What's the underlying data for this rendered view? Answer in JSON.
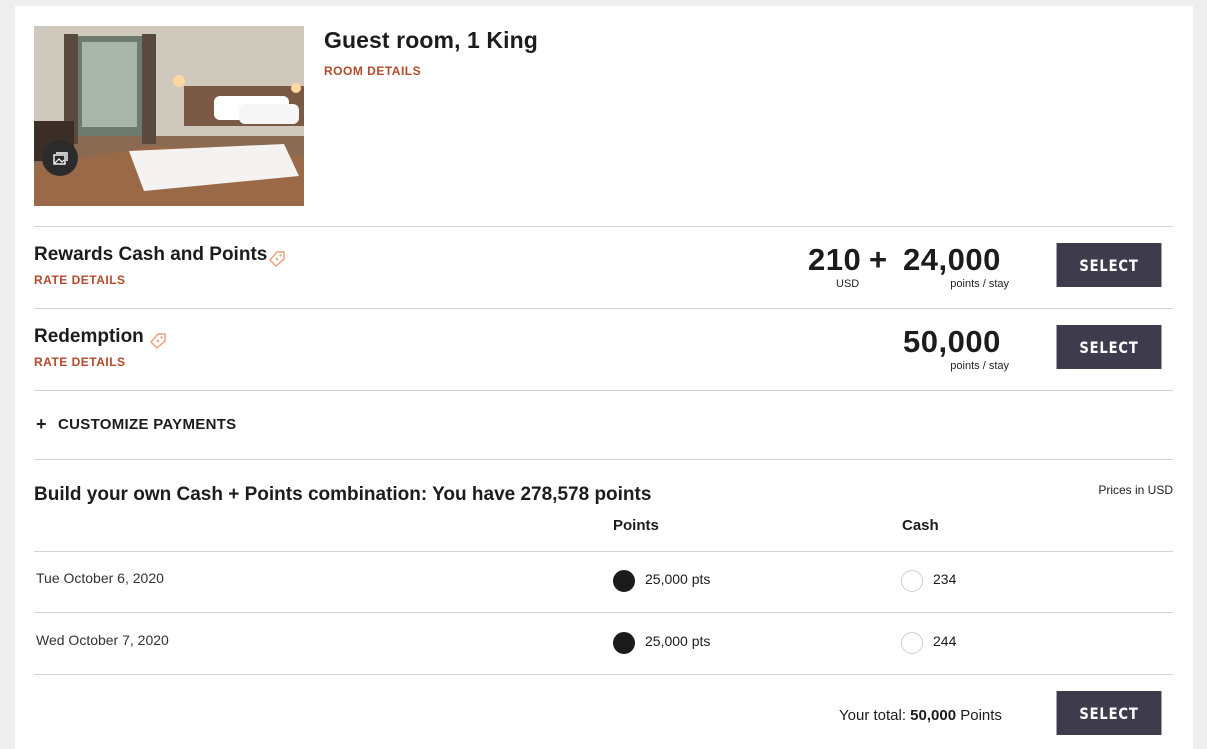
{
  "room": {
    "title": "Guest room, 1 King",
    "details_link": "ROOM DETAILS",
    "photo_icon": "gallery-icon"
  },
  "rates": [
    {
      "name": "Rewards Cash and Points",
      "details_link": "RATE DETAILS",
      "cash_amount": "210",
      "plus": "+",
      "points_amount": "24,000",
      "cash_unit": "USD",
      "points_unit": "points / stay",
      "button": "SELECT"
    },
    {
      "name": "Redemption",
      "details_link": "RATE DETAILS",
      "points_amount": "50,000",
      "points_unit": "points / stay",
      "button": "SELECT"
    }
  ],
  "customize": {
    "toggle_symbol": "+",
    "label": "CUSTOMIZE PAYMENTS"
  },
  "builder": {
    "title": "Build your own Cash + Points combination: You have 278,578 points",
    "prices_note": "Prices in USD",
    "col_points": "Points",
    "col_cash": "Cash",
    "rows": [
      {
        "date": "Tue October 6, 2020",
        "points": "25,000 pts",
        "cash": "234",
        "selected": "points"
      },
      {
        "date": "Wed October 7, 2020",
        "points": "25,000 pts",
        "cash": "244",
        "selected": "points"
      }
    ],
    "total_prefix": "Your total:",
    "total_value": "50,000",
    "total_suffix": "Points",
    "button": "SELECT"
  },
  "colors": {
    "accent_link": "#b24a2b",
    "button_bg": "#3e3b4c",
    "tag_icon": "#e8a07c"
  }
}
